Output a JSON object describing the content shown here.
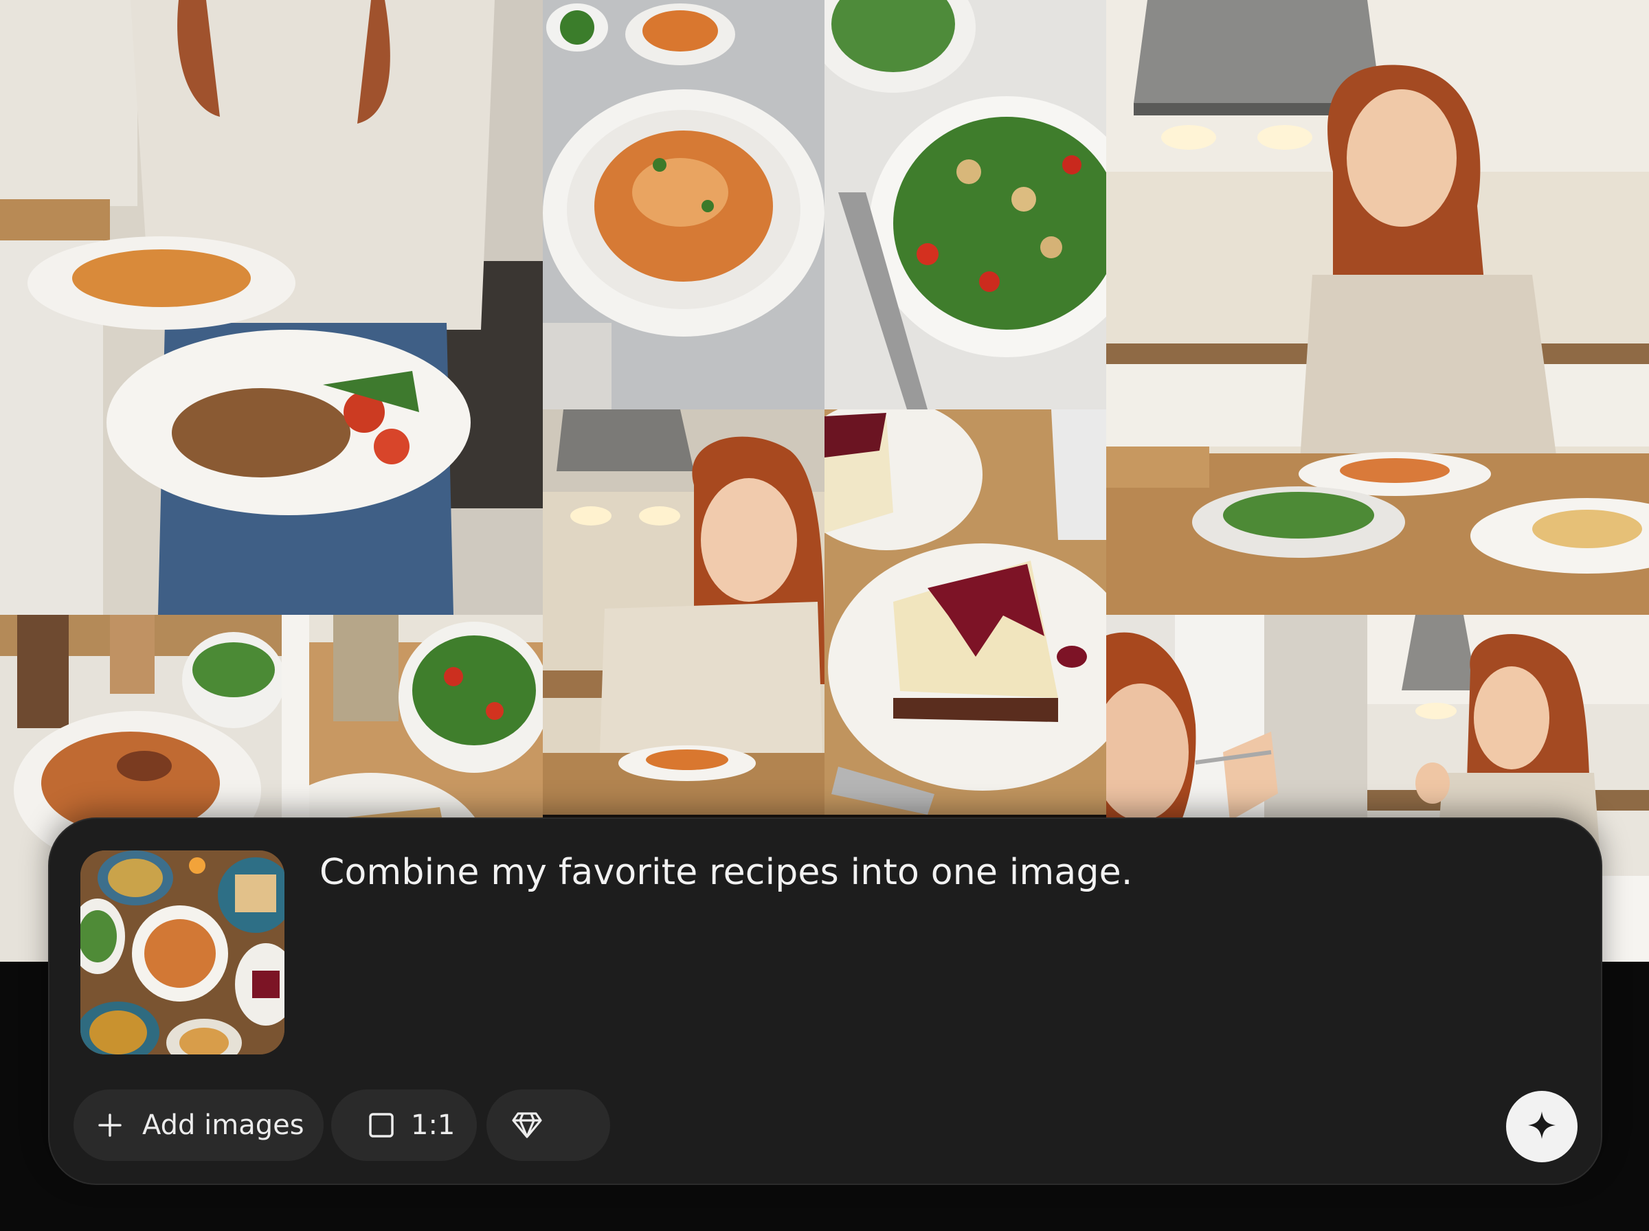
{
  "gallery": {
    "tiles": [
      {
        "name": "woman-holding-two-plates"
      },
      {
        "name": "penne-pasta-bowl"
      },
      {
        "name": "chicken-salad-bowl"
      },
      {
        "name": "woman-eating-kitchen-table"
      },
      {
        "name": "woman-eating-pasta"
      },
      {
        "name": "cheesecake-berry-sauce"
      },
      {
        "name": "pasta-and-salad-table"
      },
      {
        "name": "grilled-sandwich-salad"
      },
      {
        "name": "woman-side-profile-fork"
      },
      {
        "name": "woman-smiling-kitchen"
      }
    ]
  },
  "composer": {
    "attachment_icon": "food-collage-thumbnail",
    "prompt": "Combine my favorite recipes into one image.",
    "add_images_label": "Add images",
    "add_icon": "plus-icon",
    "aspect_ratio_label": "1:1",
    "aspect_icon": "square-icon",
    "model_icon": "gem-icon",
    "send_icon": "sparkle-icon"
  },
  "colors": {
    "composer_bg": "#1d1d1d",
    "pill_bg": "#2a2a2a",
    "text": "#f2f2f2",
    "send_bg": "#f2f2f2"
  }
}
